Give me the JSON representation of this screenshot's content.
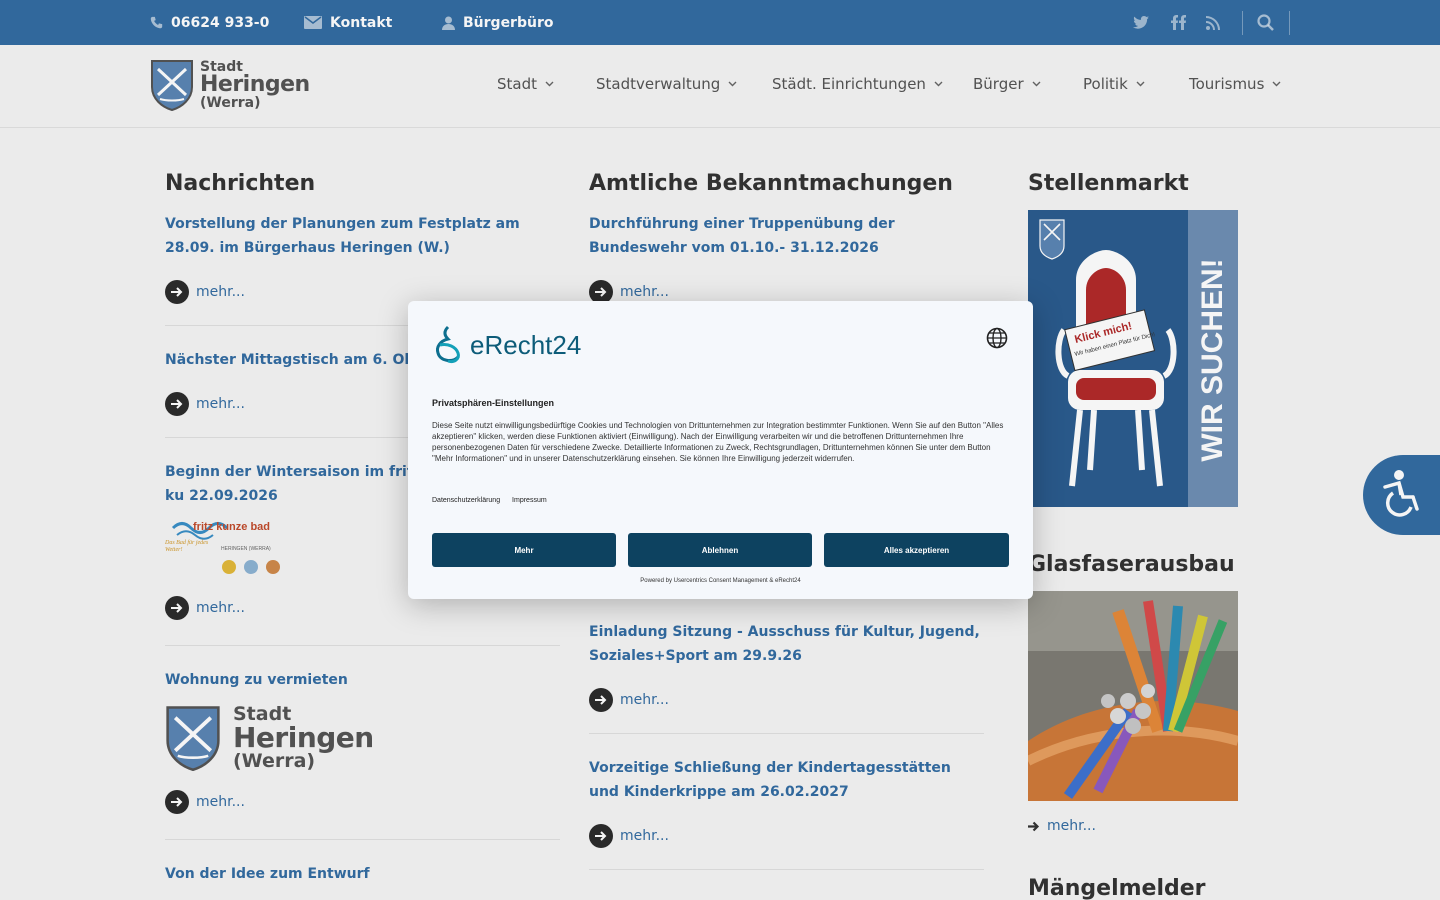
{
  "topbar": {
    "phone": "06624 933-0",
    "contact": "Kontakt",
    "office": "Bürgerbüro"
  },
  "logo": {
    "line1": "Stadt",
    "line2": "Heringen",
    "line3": "(Werra)"
  },
  "nav": [
    "Stadt",
    "Stadtverwaltung",
    "Städt. Einrichtungen",
    "Bürger",
    "Politik",
    "Tourismus"
  ],
  "news": {
    "title": "Nachrichten",
    "items": [
      "Vorstellung der Planungen zum Festplatz am 28.09. im Bürgerhaus Heringen (W.)",
      "Nächster Mittagstisch am 6. Oktob",
      "Beginn der Wintersaison im fritz-ku 22.09.2026",
      "Wohnung zu vermieten",
      "Von der Idee zum Entwurf"
    ],
    "more": "mehr...",
    "bad_logo": {
      "brand": "fritz kunze bad",
      "place": "HERINGEN (WERRA)",
      "slogan": "Das Bad für jedes Wetter!"
    }
  },
  "notices": {
    "title": "Amtliche Bekanntmachungen",
    "items": [
      "Durchführung einer Truppenübung der Bundeswehr vom 01.10.- 31.12.2026",
      "Einladung Sitzung - Ausschuss für Kultur, Jugend, Soziales+Sport am 29.9.26",
      "Vorzeitige Schließung der Kindertagesstätten und Kinderkrippe am 26.02.2027"
    ],
    "more": "mehr..."
  },
  "sidebar": {
    "jobs_title": "Stellenmarkt",
    "jobs_banner": {
      "vertical": "WIR SUCHEN!",
      "sign1": "Klick mich!",
      "sign2": "Wir haben einen Platz für Dich!"
    },
    "fiber_title": "Glasfaserausbau",
    "fiber_more": "mehr...",
    "defects_title": "Mängelmelder"
  },
  "consent": {
    "brand": "eRecht24",
    "title": "Privatsphären-Einstellungen",
    "text": "Diese Seite nutzt einwilligungsbedürftige Cookies und Technologien von Drittunternehmen zur Integration bestimmter Funktionen. Wenn Sie auf den Button \"Alles akzeptieren\" klicken, werden diese Funktionen aktiviert (Einwilligung). Nach der Einwilligung verarbeiten wir und die betroffenen Drittunternehmen Ihre personenbezogenen Daten für verschiedene Zwecke. Detaillierte Informationen zu Zweck, Rechtsgrundlagen, Drittunternehmen können Sie unter dem Button \"Mehr Informationen\" und in unserer Datenschutzerklärung einsehen. Sie können Ihre Einwilligung jederzeit widerrufen.",
    "link_privacy": "Datenschutzerklärung",
    "link_imprint": "Impressum",
    "btn_more": "Mehr",
    "btn_decline": "Ablehnen",
    "btn_accept": "Alles akzeptieren",
    "powered": "Powered by Usercentrics Consent Management & eRecht24"
  },
  "colors": {
    "primary": "#346da3",
    "consent_button": "#0d4260"
  }
}
